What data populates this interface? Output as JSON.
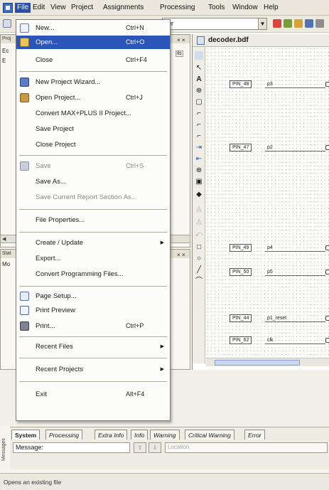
{
  "menubar": {
    "items": [
      "File",
      "Edit",
      "View",
      "Project",
      "Assignments",
      "Processing",
      "Tools",
      "Window",
      "Help"
    ]
  },
  "toolbar": {
    "combo_value": "der"
  },
  "left_panels": {
    "top_label": "Proj",
    "mid_labels": [
      "Ec",
      "E"
    ],
    "right_tab": "ils",
    "status_label": "Stat",
    "status_sub": "Mo"
  },
  "file_menu": {
    "items": [
      {
        "label": "New...",
        "shortcut": "Ctrl+N",
        "icon": "new-file-icon"
      },
      {
        "label": "Open...",
        "shortcut": "Ctrl+O",
        "icon": "open-folder-icon",
        "highlighted": true
      },
      {
        "label": "Close",
        "shortcut": "Ctrl+F4"
      },
      {
        "label": "New Project Wizard...",
        "icon": "wizard-icon"
      },
      {
        "label": "Open Project...",
        "shortcut": "Ctrl+J",
        "icon": "open-project-icon"
      },
      {
        "label": "Convert MAX+PLUS II Project..."
      },
      {
        "label": "Save Project"
      },
      {
        "label": "Close Project"
      },
      {
        "label": "Save",
        "shortcut": "Ctrl+S",
        "icon": "save-icon",
        "disabled": true
      },
      {
        "label": "Save As..."
      },
      {
        "label": "Save Current Report Section As...",
        "disabled": true
      },
      {
        "label": "File Properties..."
      },
      {
        "label": "Create / Update",
        "submenu": true
      },
      {
        "label": "Export..."
      },
      {
        "label": "Convert Programming Files..."
      },
      {
        "label": "Page Setup...",
        "icon": "page-setup-icon"
      },
      {
        "label": "Print Preview",
        "icon": "print-preview-icon"
      },
      {
        "label": "Print...",
        "shortcut": "Ctrl+P",
        "icon": "printer-icon"
      },
      {
        "label": "Recent Files",
        "submenu": true
      },
      {
        "label": "Recent Projects",
        "submenu": true
      },
      {
        "label": "Exit",
        "shortcut": "Alt+F4"
      }
    ]
  },
  "design": {
    "title": "decoder.bdf",
    "pins": [
      {
        "pin": "PIN_48",
        "signal": "p3"
      },
      {
        "pin": "PIN_47",
        "signal": "p2"
      },
      {
        "pin": "PIN_49",
        "signal": "p4"
      },
      {
        "pin": "PIN_50",
        "signal": "p5"
      },
      {
        "pin": "PIN_44",
        "signal": "p1_reset"
      },
      {
        "pin": "PIN_62",
        "signal": "clk"
      }
    ]
  },
  "messages": {
    "tabs": [
      "System",
      "Processing",
      "Extra Info",
      "Info",
      "Warning",
      "Critical Warning",
      "Error"
    ],
    "message_label": "Message:",
    "location_placeholder": "Location",
    "side_label": "Messages"
  },
  "status": {
    "text": "Opens an existing file"
  },
  "colors": {
    "highlight": "#2b55b8",
    "menubar_bg": "#ebe7dc"
  }
}
